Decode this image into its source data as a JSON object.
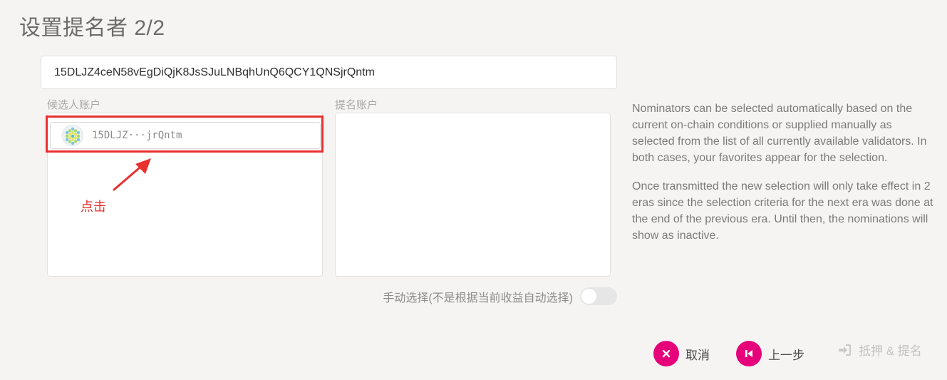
{
  "modal": {
    "title": "设置提名者 2/2"
  },
  "address_input": {
    "value": "15DLJZ4ceN58vEgDiQjK8JsSJuLNBqhUnQ6QCY1QNSjrQntm"
  },
  "candidates": {
    "label": "候选人账户",
    "items": [
      {
        "address": "15DLJZ···jrQntm"
      }
    ]
  },
  "nominated": {
    "label": "提名账户"
  },
  "annotation": {
    "label": "点击",
    "color": "#e8302f"
  },
  "manual_select": {
    "label": "手动选择(不是根据当前收益自动选择)",
    "enabled": false
  },
  "help": {
    "paragraph1": "Nominators can be selected automatically based on the current on-chain conditions or supplied manually as selected from the list of all currently available validators. In both cases, your favorites appear for the selection.",
    "paragraph2": "Once transmitted the new selection will only take effect in 2 eras since the selection criteria for the next era was done at the end of the previous era. Until then, the nominations will show as inactive."
  },
  "actions": {
    "cancel_label": "取消",
    "prev_label": "上一步",
    "submit_label": "抵押 & 提名"
  },
  "colors": {
    "accent": "#e6007a",
    "background": "#f5f4f3"
  }
}
